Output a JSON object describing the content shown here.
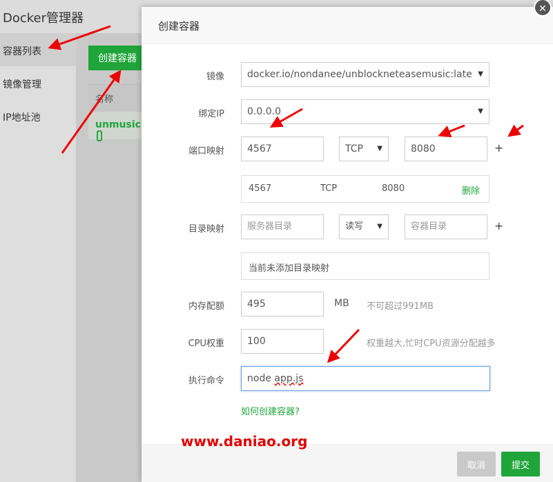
{
  "background": {
    "app_title": "Docker管理器",
    "sidebar": [
      "容器列表",
      "镜像管理",
      "IP地址池"
    ],
    "create_button": "创建容器",
    "table_header": "名称",
    "table_row": "unmusic"
  },
  "modal": {
    "title": "创建容器",
    "close": "✕",
    "image_label": "镜像",
    "image_value": "docker.io/nondanee/unblockneteasemusic:late",
    "bind_ip_label": "绑定IP",
    "bind_ip_value": "0.0.0.0",
    "port_label": "端口映射",
    "port_host": "4567",
    "port_protocol": "TCP",
    "port_container": "8080",
    "plus": "+",
    "port_list": [
      {
        "host": "4567",
        "protocol": "TCP",
        "container": "8080",
        "action": "删除"
      }
    ],
    "dir_label": "目录映射",
    "dir_host_placeholder": "服务器目录",
    "dir_mode": "读写",
    "dir_container_placeholder": "容器目录",
    "dir_empty": "当前未添加目录映射",
    "mem_label": "内存配额",
    "mem_value": "495",
    "mem_unit": "MB",
    "mem_hint": "不可超过991MB",
    "cpu_label": "CPU权重",
    "cpu_value": "100",
    "cpu_hint": "权重越大,忙时CPU资源分配越多",
    "cmd_label": "执行命令",
    "cmd_value_a": "node ",
    "cmd_value_b": "app.js",
    "help_link": "如何创建容器?",
    "cancel": "取消",
    "submit": "提交"
  },
  "watermark": "www.daniao.org",
  "colors": {
    "accent": "#20a53a",
    "arrow": "#ee0000"
  }
}
